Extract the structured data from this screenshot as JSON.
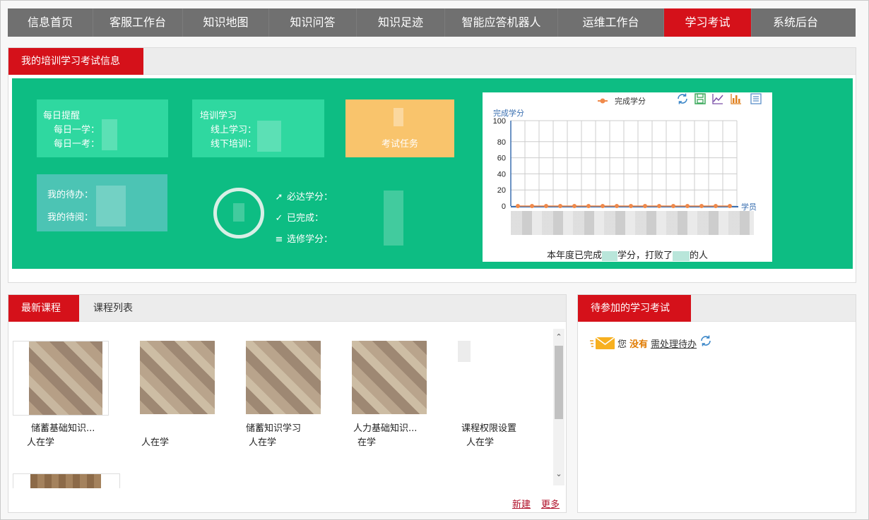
{
  "nav": {
    "items": [
      {
        "label": "信息首页",
        "active": false
      },
      {
        "label": "客服工作台",
        "active": false
      },
      {
        "label": "知识地图",
        "active": false
      },
      {
        "label": "知识问答",
        "active": false
      },
      {
        "label": "知识足迹",
        "active": false
      },
      {
        "label": "智能应答机器人",
        "active": false
      },
      {
        "label": "运维工作台",
        "active": false
      },
      {
        "label": "学习考试",
        "active": true
      },
      {
        "label": "系统后台",
        "active": false
      }
    ]
  },
  "training_panel": {
    "tab_label": "我的培训学习考试信息",
    "daily": {
      "title": "每日提醒",
      "study": "每日一学：",
      "exam": "每日一考："
    },
    "training": {
      "title": "培训学习",
      "online": "线上学习：",
      "offline": "线下培训："
    },
    "exam_task": {
      "label": "考试任务"
    },
    "pending": {
      "todo": "我的待办：",
      "read": "我的待阅："
    },
    "credits": {
      "required": "必达学分：",
      "completed": "已完成：",
      "elective": "选修学分："
    },
    "chart_footer": {
      "prefix": "本年度已完成",
      "mid": "学分，打败了",
      "suffix": "的人"
    }
  },
  "chart_data": {
    "type": "line",
    "legend": "完成学分",
    "legend_position": "top",
    "ylabel": "完成学分",
    "xlabel": "学员",
    "ylim": [
      0,
      100
    ],
    "yticks": [
      "100",
      "80",
      "60",
      "40",
      "20",
      "0"
    ],
    "grid": true,
    "series": [
      {
        "name": "完成学分",
        "values": [
          0,
          0,
          0,
          0,
          0,
          0,
          0,
          0,
          0,
          0,
          0,
          0,
          0,
          0,
          0,
          0
        ]
      }
    ],
    "colors": {
      "line": "#f08a4b",
      "axis": "#3a6fb0",
      "grid": "#cccccc"
    },
    "toolbox": [
      "refresh-icon",
      "save-icon",
      "line-chart-icon",
      "bar-chart-icon",
      "data-view-icon"
    ]
  },
  "courses_panel": {
    "tabs": [
      {
        "label": "最新课程",
        "active": true
      },
      {
        "label": "课程列表",
        "active": false
      }
    ],
    "courses": [
      {
        "title": "储蓄基础知识...",
        "count": "人在学"
      },
      {
        "title": "",
        "count": "人在学"
      },
      {
        "title": "储蓄知识学习",
        "count": "人在学"
      },
      {
        "title": "人力基础知识...",
        "count": "在学"
      },
      {
        "title": "课程权限设置",
        "count": "人在学"
      }
    ],
    "links": {
      "new": "新建",
      "more": "更多"
    }
  },
  "exam_panel": {
    "tab_label": "待参加的学习考试",
    "todo": {
      "you": "您",
      "none": "没有",
      "link": "需处理待办"
    }
  },
  "colors": {
    "accent": "#d5111a",
    "nav_bg": "#707070",
    "board": "#0dbd83",
    "card": "#2fd8a0",
    "orange": "#f9c46c",
    "teal": "#4cc4b4"
  }
}
